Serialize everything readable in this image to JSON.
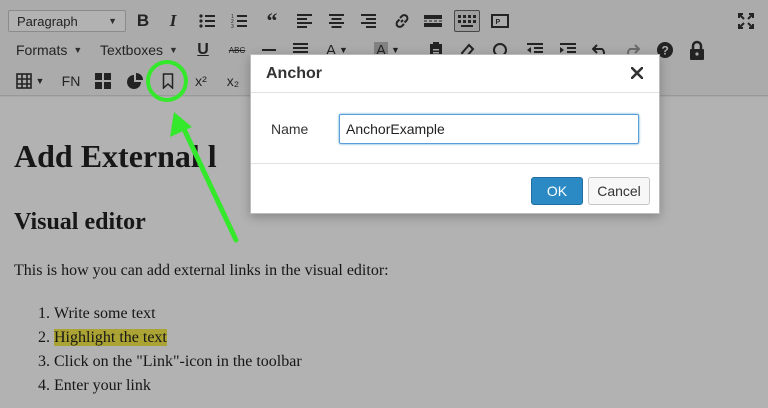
{
  "toolbar": {
    "format_select": "Paragraph",
    "formats_label": "Formats",
    "textboxes_label": "Textboxes",
    "strike_label": "ABC",
    "fn_label": "FN",
    "superscript_label": "x²",
    "subscript_label": "x₂"
  },
  "editor": {
    "heading1": "Add External l",
    "heading2": "Visual editor",
    "paragraph": "This is how you can add external links in the visual editor:",
    "steps": [
      {
        "num": "1.",
        "text": "Write some text"
      },
      {
        "num": "2.",
        "text": "Highlight the text"
      },
      {
        "num": "3.",
        "text": "Click on the \"Link\"-icon in the toolbar"
      },
      {
        "num": "4.",
        "text": "Enter your link"
      }
    ]
  },
  "dialog": {
    "title": "Anchor",
    "name_label": "Name",
    "name_value": "AnchorExample",
    "ok_label": "OK",
    "cancel_label": "Cancel"
  },
  "annotation": {
    "color": "#34e82c",
    "target": "anchor-button"
  },
  "colors": {
    "accent": "#2b8ac4",
    "highlight": "#f5ea4a"
  }
}
